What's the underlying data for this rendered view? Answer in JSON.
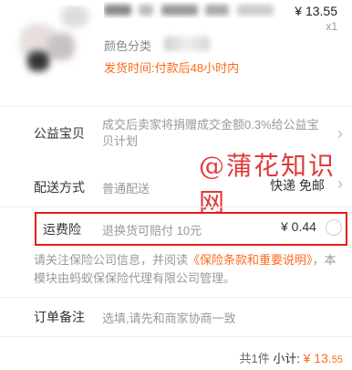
{
  "product": {
    "price": "¥ 13.55",
    "quantity": "x1",
    "color_label": "颜色分类",
    "ship_time": "发货时间:付款后48小时内"
  },
  "charity": {
    "label": "公益宝贝",
    "text": "成交后卖家将捐赠成交金额0.3%给公益宝贝计划"
  },
  "watermark": "@蒲花知识网",
  "delivery": {
    "label": "配送方式",
    "value": "普通配送",
    "right": "快递 免邮"
  },
  "insurance": {
    "label": "运费险",
    "desc": "退换货可赔付 10元",
    "price": "¥ 0.44",
    "accent": "#e32019"
  },
  "notice": {
    "prefix": "请关注保险公司信息，并阅读",
    "link": "《保险条款和重要说明》",
    "suffix": "，本模块由蚂蚁保保险代理有限公司管理。"
  },
  "remark": {
    "label": "订单备注",
    "placeholder": "选填,请先和商家协商一致"
  },
  "footer": {
    "count": "共1件",
    "subtotal_label": "小计:",
    "total_int": "¥ 13.",
    "total_dec": "55"
  },
  "colors": {
    "orange": "#ff6a1a",
    "grey_text": "#999999",
    "watermark": "#e03a3a"
  }
}
